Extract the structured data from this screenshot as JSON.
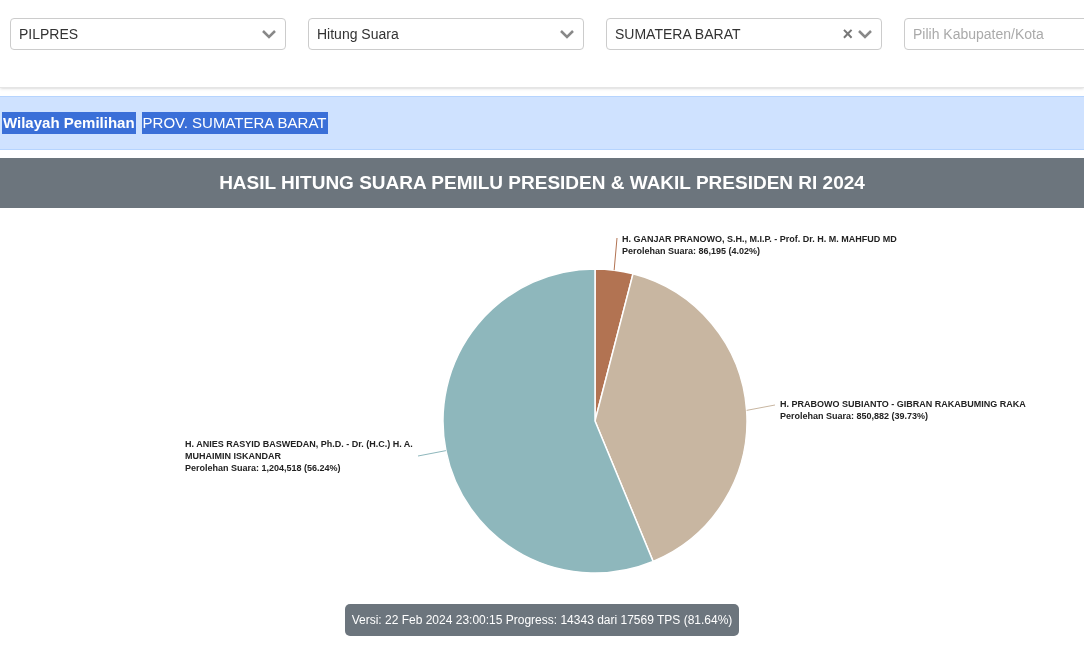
{
  "filters": [
    {
      "value": "PILPRES"
    },
    {
      "value": "Hitung Suara"
    },
    {
      "value": "SUMATERA BARAT",
      "clear_icon": "×"
    },
    {
      "placeholder": "Pilih Kabupaten/Kota"
    }
  ],
  "region": {
    "label": "Wilayah Pemilihan",
    "value": "PROV. SUMATERA BARAT"
  },
  "title": "HASIL HITUNG SUARA PEMILU PRESIDEN & WAKIL PRESIDEN RI 2024",
  "chart_data": {
    "type": "pie",
    "categories": [
      "H. GANJAR PRANOWO, S.H., M.I.P. - Prof. Dr. H. M. MAHFUD MD",
      "H. PRABOWO SUBIANTO - GIBRAN RAKABUMING RAKA",
      "H. ANIES RASYID BASWEDAN, Ph.D. - Dr. (H.C.) H. A. MUHAIMIN ISKANDAR"
    ],
    "values": [
      4.02,
      39.73,
      56.24
    ],
    "colors": [
      "#b27352",
      "#c8b6a1",
      "#8eb7bc"
    ],
    "value_labels": [
      "Perolehan Suara: 86,195 (4.02%)",
      "Perolehan Suara: 850,882 (39.73%)",
      "Perolehan Suara: 1,204,518 (56.24%)"
    ]
  },
  "footer": "Versi: 22 Feb 2024 23:00:15 Progress: 14343 dari 17569 TPS (81.64%)"
}
